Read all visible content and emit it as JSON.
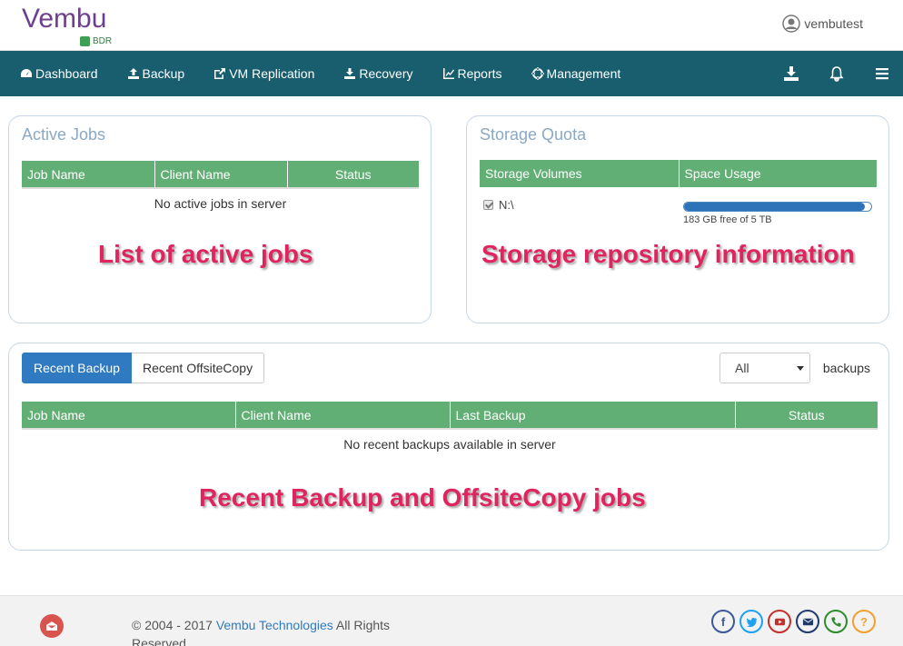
{
  "header": {
    "logo_text": "Vembu",
    "logo_sub": "BDR",
    "username": "vembutest"
  },
  "nav": {
    "items": [
      {
        "label": "Dashboard",
        "icon": "dashboard-icon"
      },
      {
        "label": "Backup",
        "icon": "upload-icon"
      },
      {
        "label": "VM Replication",
        "icon": "share-icon"
      },
      {
        "label": "Recovery",
        "icon": "download-icon"
      },
      {
        "label": "Reports",
        "icon": "line-chart-icon"
      },
      {
        "label": "Management",
        "icon": "crosshair-icon"
      }
    ],
    "right_icons": [
      "download-icon",
      "bell-icon",
      "hamburger-icon"
    ]
  },
  "active_jobs": {
    "title": "Active Jobs",
    "columns": [
      "Job Name",
      "Client Name",
      "Status"
    ],
    "empty_text": "No active jobs in server",
    "annotation": "List of active jobs"
  },
  "storage_quota": {
    "title": "Storage Quota",
    "columns": [
      "Storage Volumes",
      "Space Usage"
    ],
    "volume": "N:\\",
    "usage_fraction": 0.964,
    "usage_text": "183 GB free of 5 TB",
    "annotation": "Storage repository information"
  },
  "recent": {
    "tabs": [
      "Recent Backup",
      "Recent OffsiteCopy"
    ],
    "active_tab": 0,
    "filter_value": "All",
    "filter_suffix": "backups",
    "columns": [
      "Job Name",
      "Client Name",
      "Last Backup",
      "Status"
    ],
    "empty_text": "No recent backups available in server",
    "annotation": "Recent Backup and OffsiteCopy jobs"
  },
  "footer": {
    "copyright_prefix": "© 2004 - 2017 ",
    "company_link": "Vembu Technologies",
    "copyright_suffix": " All Rights Reserved",
    "social_icons": [
      "facebook-icon",
      "twitter-icon",
      "youtube-icon",
      "email-icon",
      "phone-icon",
      "help-icon"
    ],
    "social_colors": [
      "#3b5998",
      "#1da1f2",
      "#c4302b",
      "#1f3a6b",
      "#2e8b2e",
      "#f0a030"
    ]
  }
}
